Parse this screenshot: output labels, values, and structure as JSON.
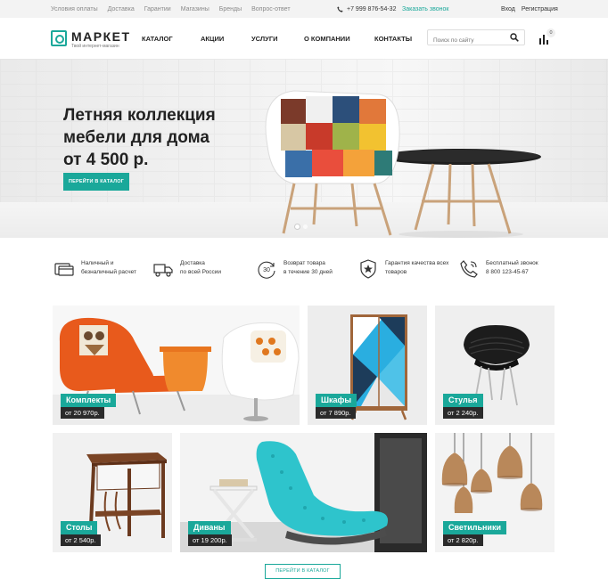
{
  "topbar": {
    "links": [
      "Условия оплаты",
      "Доставка",
      "Гарантии",
      "Магазины",
      "Бренды",
      "Вопрос-ответ"
    ],
    "phone": "+7 999 876-54-32",
    "callback": "Заказать звонок",
    "login": "Вход",
    "register": "Регистрация"
  },
  "header": {
    "logo_name": "МАРКЕТ",
    "logo_tagline": "Твой интернет-магазин",
    "nav": [
      "КАТАЛОГ",
      "АКЦИИ",
      "УСЛУГИ",
      "О КОМПАНИИ",
      "КОНТАКТЫ"
    ],
    "search_placeholder": "Поиск по сайту",
    "cart_count": "0"
  },
  "hero": {
    "title": "Летняя коллекция\nмебели для дома\nот 4 500 р.",
    "button": "ПЕРЕЙТИ В КАТАЛОГ",
    "slides": 2,
    "active_slide": 1
  },
  "features": [
    {
      "icon": "wallet-card-icon",
      "text": "Наличный и\nбезналичный расчет"
    },
    {
      "icon": "truck-icon",
      "text": "Доставка\nпо всей России"
    },
    {
      "icon": "return-30-icon",
      "text": "Возврат товара\nв течение 30 дней",
      "badge": "30"
    },
    {
      "icon": "shield-star-icon",
      "text": "Гарантия качества всех\nтоваров"
    },
    {
      "icon": "phone-icon",
      "text": "Бесплатный звонок\n8 800 123-45-67"
    }
  ],
  "categories": [
    {
      "name": "Комплекты",
      "price": "от 20 970р."
    },
    {
      "name": "Шкафы",
      "price": "от 7 890р."
    },
    {
      "name": "Стулья",
      "price": "от 2 240р."
    },
    {
      "name": "Столы",
      "price": "от 2 540р."
    },
    {
      "name": "Диваны",
      "price": "от 19 200р."
    },
    {
      "name": "Светильники",
      "price": "от 2 820р."
    }
  ],
  "catalog_button": "ПЕРЕЙТИ В КАТАЛОГ",
  "colors": {
    "accent": "#1aa89a",
    "dark": "#2b2b2b",
    "topbar": "#f3f3f3"
  }
}
